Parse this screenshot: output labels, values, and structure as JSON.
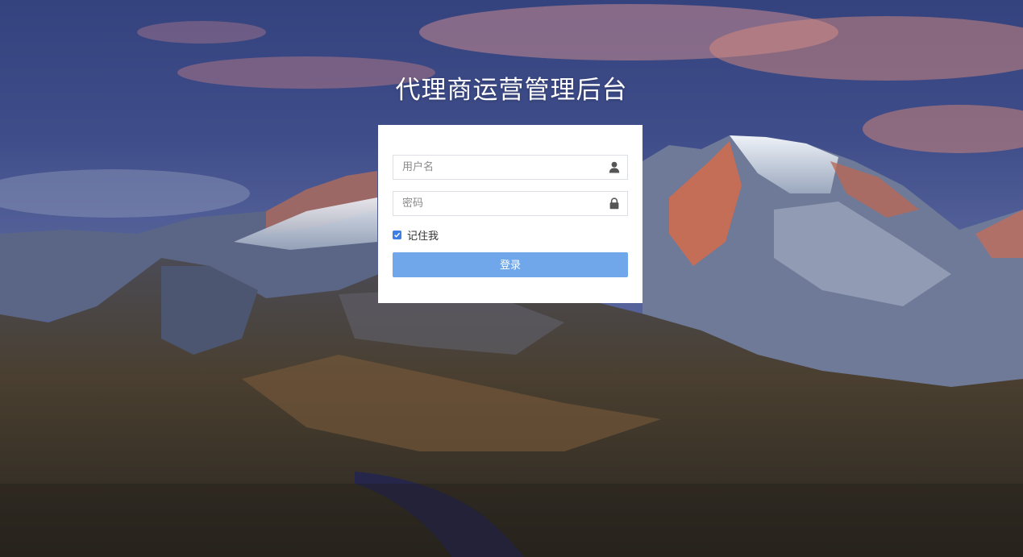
{
  "page": {
    "title": "代理商运营管理后台"
  },
  "login": {
    "username_placeholder": "用户名",
    "password_placeholder": "密码",
    "remember_label": "记住我",
    "remember_checked": true,
    "submit_label": "登录",
    "username_icon": "user-icon",
    "password_icon": "lock-icon"
  },
  "colors": {
    "button": "#6fa7ea",
    "checkbox": "#3d7fe3"
  }
}
